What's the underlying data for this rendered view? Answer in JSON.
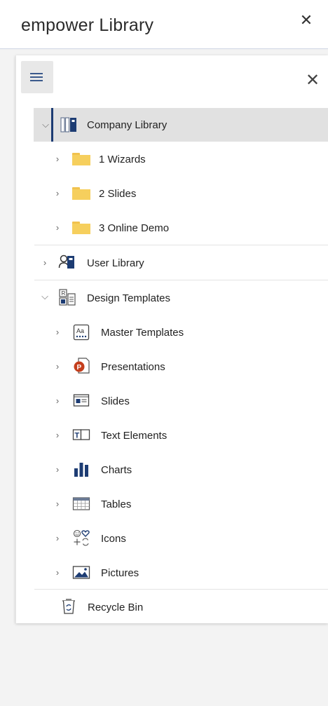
{
  "window": {
    "title": "empower Library",
    "close_glyph": "✕"
  },
  "panel": {
    "close_glyph": "✕"
  },
  "tree": {
    "company_library": {
      "label": "Company Library",
      "icon": "company-library-icon"
    },
    "folders": [
      {
        "label": "1 Wizards",
        "icon": "folder-icon"
      },
      {
        "label": "2 Slides",
        "icon": "folder-icon"
      },
      {
        "label": "3 Online Demo",
        "icon": "folder-icon"
      }
    ],
    "user_library": {
      "label": "User Library",
      "icon": "user-library-icon"
    },
    "design_templates": {
      "label": "Design Templates",
      "icon": "design-templates-icon"
    },
    "templates": [
      {
        "label": "Master Templates",
        "icon": "master-templates-icon"
      },
      {
        "label": "Presentations",
        "icon": "presentation-icon"
      },
      {
        "label": "Slides",
        "icon": "slides-icon"
      },
      {
        "label": "Text Elements",
        "icon": "text-elements-icon"
      },
      {
        "label": "Charts",
        "icon": "charts-icon"
      },
      {
        "label": "Tables",
        "icon": "tables-icon"
      },
      {
        "label": "Icons",
        "icon": "icons-icon"
      },
      {
        "label": "Pictures",
        "icon": "pictures-icon"
      }
    ],
    "recycle_bin": {
      "label": "Recycle Bin",
      "icon": "recycle-bin-icon"
    }
  },
  "colors": {
    "accent": "#1d3c73",
    "selected_bg": "#e1e1e1",
    "folder": "#f6cf5d",
    "powerpoint": "#c43e1c"
  }
}
